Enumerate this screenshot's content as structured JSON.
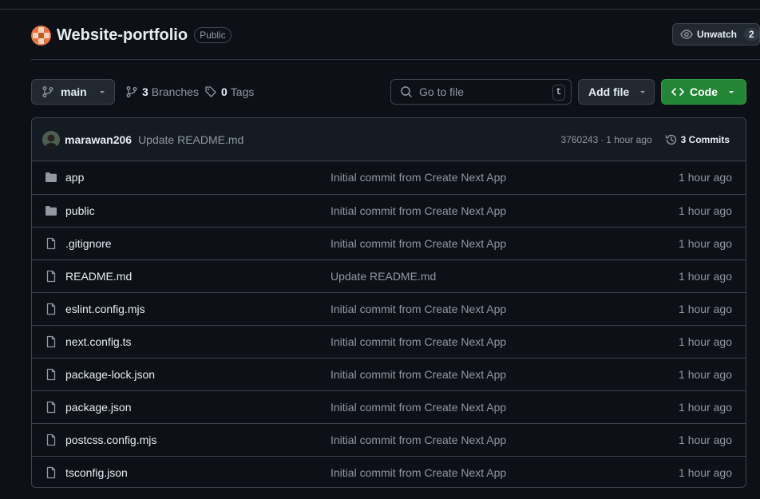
{
  "repo": {
    "name": "Website-portfolio",
    "visibility": "Public",
    "watch_label": "Unwatch",
    "watch_count": "2"
  },
  "toolbar": {
    "branch": "main",
    "branches_count": "3",
    "branches_label": "Branches",
    "tags_count": "0",
    "tags_label": "Tags",
    "goto_placeholder": "Go to file",
    "goto_shortcut": "t",
    "add_file_label": "Add file",
    "code_label": "Code"
  },
  "latest_commit": {
    "author": "marawan206",
    "message": "Update README.md",
    "hash": "3760243",
    "separator": "·",
    "time": "1 hour ago",
    "commits_label": "3 Commits"
  },
  "files": [
    {
      "name": "app",
      "type": "folder",
      "message": "Initial commit from Create Next App",
      "time": "1 hour ago"
    },
    {
      "name": "public",
      "type": "folder",
      "message": "Initial commit from Create Next App",
      "time": "1 hour ago"
    },
    {
      "name": ".gitignore",
      "type": "file",
      "message": "Initial commit from Create Next App",
      "time": "1 hour ago"
    },
    {
      "name": "README.md",
      "type": "file",
      "message": "Update README.md",
      "time": "1 hour ago"
    },
    {
      "name": "eslint.config.mjs",
      "type": "file",
      "message": "Initial commit from Create Next App",
      "time": "1 hour ago"
    },
    {
      "name": "next.config.ts",
      "type": "file",
      "message": "Initial commit from Create Next App",
      "time": "1 hour ago"
    },
    {
      "name": "package-lock.json",
      "type": "file",
      "message": "Initial commit from Create Next App",
      "time": "1 hour ago"
    },
    {
      "name": "package.json",
      "type": "file",
      "message": "Initial commit from Create Next App",
      "time": "1 hour ago"
    },
    {
      "name": "postcss.config.mjs",
      "type": "file",
      "message": "Initial commit from Create Next App",
      "time": "1 hour ago"
    },
    {
      "name": "tsconfig.json",
      "type": "file",
      "message": "Initial commit from Create Next App",
      "time": "1 hour ago"
    }
  ],
  "colors": {
    "background": "#0d1117",
    "border": "#3d444d",
    "muted_text": "#9198a1",
    "code_button": "#238636",
    "repo_avatar": "#e8743b"
  },
  "icons": {
    "repo_avatar": "repo-avatar-icon",
    "watch": "eye-icon",
    "branch": "git-branch-icon",
    "tag": "tag-icon",
    "search": "search-icon",
    "code": "code-icon",
    "history": "history-icon",
    "folder": "folder-icon",
    "file": "file-icon"
  }
}
